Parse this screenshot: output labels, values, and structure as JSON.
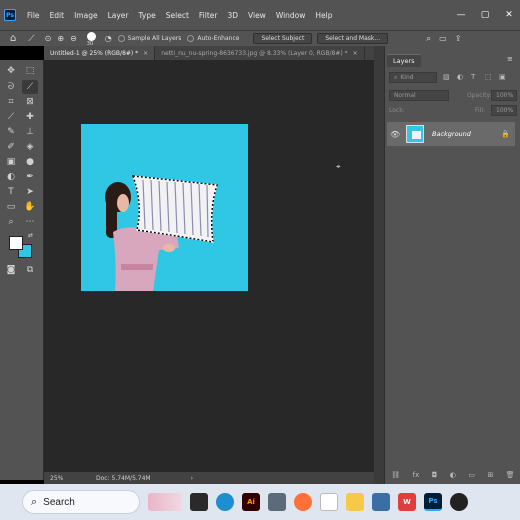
{
  "app": {
    "logo_text": "Ps"
  },
  "menu": [
    "File",
    "Edit",
    "Image",
    "Layer",
    "Type",
    "Select",
    "Filter",
    "3D",
    "View",
    "Window",
    "Help"
  ],
  "window_controls": {
    "minimize": "—",
    "maximize": "▢",
    "close": "✕"
  },
  "options_bar": {
    "brush_size": "30",
    "sample_all_layers": "Sample All Layers",
    "auto_enhance": "Auto-Enhance",
    "select_subject": "Select Subject",
    "select_and_mask": "Select and Mask..."
  },
  "tabs": [
    {
      "label": "Untitled-1 @ 25% (RGB/8#) *",
      "close": "×"
    },
    {
      "label": "netti_nu_nu-spring-8636733.jpg @ 8.33% (Layer 0, RGB/8#) *",
      "close": "×"
    }
  ],
  "status": {
    "zoom": "25%",
    "doc": "Doc: 5.74M/5.74M"
  },
  "layers_panel": {
    "tab_label": "Layers",
    "kind_placeholder": "Kind",
    "blend_mode": "Normal",
    "opacity_label": "Opacity:",
    "opacity_value": "100%",
    "lock_label": "Lock:",
    "fill_label": "Fill:",
    "fill_value": "100%",
    "layers": [
      {
        "name": "Background",
        "visible": true,
        "locked": true
      }
    ]
  },
  "taskbar": {
    "search_placeholder": "Search"
  },
  "colors": {
    "doc_background": "#2fc7e3",
    "foreground_swatch": "#ffffff",
    "background_swatch": "#2fc7e3",
    "selection_ants": "#000000"
  }
}
